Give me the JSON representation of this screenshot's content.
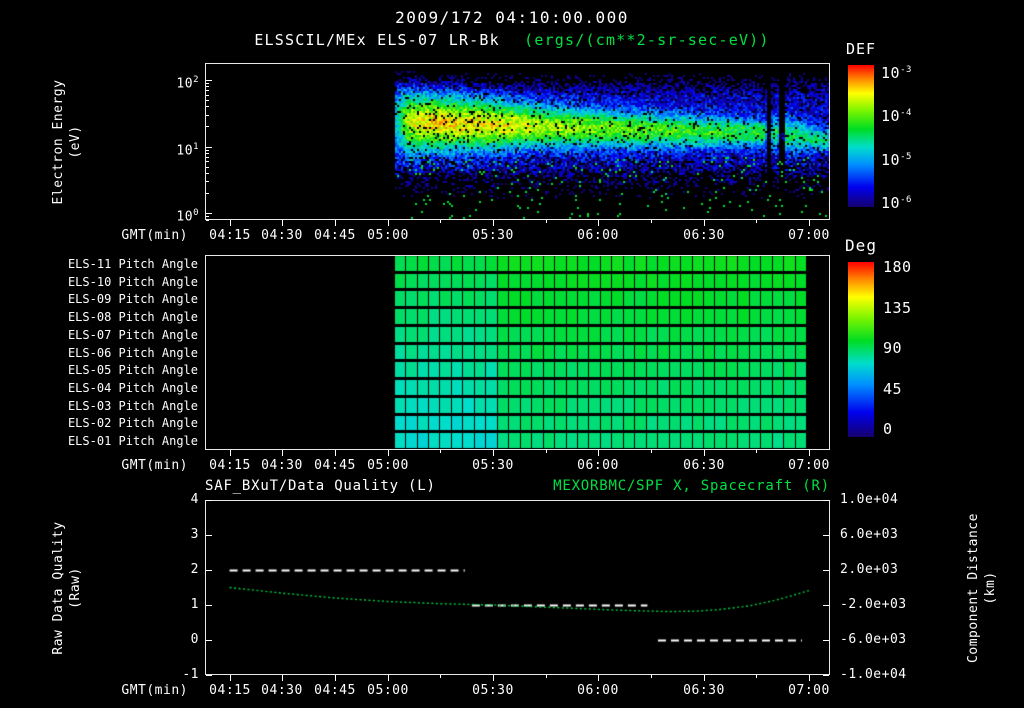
{
  "header": {
    "title": "2009/172 04:10:00.000",
    "subtitle_instrument": "ELSSCIL/MEx ELS-07 LR-Bk",
    "subtitle_units": "(ergs/(cm**2-sr-sec-eV))"
  },
  "colors": {
    "background": "#000000",
    "text": "#ffffff",
    "green_text": "#00e040",
    "curve_green": "#00cc44",
    "quality_line": "#ffffff",
    "colormap_stops": [
      {
        "pos": 0.0,
        "color": "#16006e"
      },
      {
        "pos": 0.14,
        "color": "#0000ee"
      },
      {
        "pos": 0.3,
        "color": "#0090ff"
      },
      {
        "pos": 0.42,
        "color": "#00ddcc"
      },
      {
        "pos": 0.55,
        "color": "#00dd22"
      },
      {
        "pos": 0.68,
        "color": "#7cf500"
      },
      {
        "pos": 0.8,
        "color": "#ffff00"
      },
      {
        "pos": 0.9,
        "color": "#ff8800"
      },
      {
        "pos": 1.0,
        "color": "#ff0000"
      }
    ]
  },
  "time_axis": {
    "label": "GMT(min)",
    "domain_min": 248,
    "domain_max": 426,
    "minor_tick_step": 15,
    "ticks": [
      {
        "minute": 255,
        "label": "04:15"
      },
      {
        "minute": 270,
        "label": "04:30"
      },
      {
        "minute": 285,
        "label": "04:45"
      },
      {
        "minute": 300,
        "label": "05:00"
      },
      {
        "minute": 330,
        "label": "05:30"
      },
      {
        "minute": 360,
        "label": "06:00"
      },
      {
        "minute": 390,
        "label": "06:30"
      },
      {
        "minute": 420,
        "label": "07:00"
      }
    ]
  },
  "chart_data": [
    {
      "id": "electron_energy_spectrogram",
      "type": "heatmap",
      "title": "ELSSCIL/MEx ELS-07 LR-Bk",
      "units": "ergs/(cm**2-sr-sec-eV)",
      "ylabel": [
        "Electron Energy",
        "(eV)"
      ],
      "y_scale": "log",
      "y_domain_log10_ev": [
        -0.1,
        2.25
      ],
      "yticks": [
        {
          "exponent": 2
        },
        {
          "exponent": 1
        },
        {
          "exponent": 0
        }
      ],
      "colorbar": {
        "title": "DEF",
        "range_log10_flux": [
          -6,
          -3
        ],
        "ticks": [
          {
            "exponent": -3
          },
          {
            "exponent": -4
          },
          {
            "exponent": -5
          },
          {
            "exponent": -6
          }
        ]
      },
      "data_start_minute": 302,
      "data_end_minute": 426,
      "background_log_flux": -5.7,
      "noise_log_flux": 0.35,
      "band_keyframes": {
        "minute": [
          302,
          306,
          312,
          330,
          345,
          365,
          385,
          400,
          407,
          408.5,
          410.5,
          412,
          413.5,
          417,
          421,
          426
        ],
        "peak_log_flux": [
          -4.9,
          -3.8,
          -3.55,
          -3.6,
          -3.85,
          -4.05,
          -4.2,
          -4.3,
          -4.35,
          -5.3,
          -4.25,
          -5.3,
          -4.45,
          -4.5,
          -4.6,
          -4.7
        ],
        "center_log10_ev": [
          1.4,
          1.37,
          1.35,
          1.33,
          1.3,
          1.26,
          1.23,
          1.21,
          1.2,
          1.2,
          1.2,
          1.2,
          1.18,
          1.15,
          1.12,
          1.1
        ],
        "width_log10_ev": [
          0.5,
          0.46,
          0.42,
          0.36,
          0.3,
          0.27,
          0.24,
          0.21,
          0.2,
          0.2,
          0.24,
          0.2,
          0.26,
          0.24,
          0.2,
          0.18
        ]
      },
      "dropout_lanes": [
        {
          "start_minute": 408,
          "end_minute": 409.3
        },
        {
          "start_minute": 411.6,
          "end_minute": 413
        }
      ]
    },
    {
      "id": "pitch_angles",
      "type": "heatmap",
      "colorbar": {
        "title": "Deg",
        "range_deg": [
          0,
          180
        ],
        "ticks": [
          180,
          135,
          90,
          45,
          0
        ]
      },
      "data_start_minute": 302,
      "data_end_minute": 419.5,
      "time_cells": 36,
      "early_transition_minute": 330,
      "rows_deg_top_to_bottom": [
        {
          "label": "ELS-11 Pitch Angle",
          "early_deg": 94,
          "late_deg": 100
        },
        {
          "label": "ELS-10 Pitch Angle",
          "early_deg": 92,
          "late_deg": 99
        },
        {
          "label": "ELS-09 Pitch Angle",
          "early_deg": 90,
          "late_deg": 97
        },
        {
          "label": "ELS-08 Pitch Angle",
          "early_deg": 88,
          "late_deg": 96
        },
        {
          "label": "ELS-07 Pitch Angle",
          "early_deg": 86,
          "late_deg": 94
        },
        {
          "label": "ELS-06 Pitch Angle",
          "early_deg": 84,
          "late_deg": 93
        },
        {
          "label": "ELS-05 Pitch Angle",
          "early_deg": 82,
          "late_deg": 91
        },
        {
          "label": "ELS-04 Pitch Angle",
          "early_deg": 80,
          "late_deg": 90
        },
        {
          "label": "ELS-03 Pitch Angle",
          "early_deg": 78,
          "late_deg": 89
        },
        {
          "label": "ELS-02 Pitch Angle",
          "early_deg": 76,
          "late_deg": 88
        },
        {
          "label": "ELS-01 Pitch Angle",
          "early_deg": 75,
          "late_deg": 87
        }
      ]
    },
    {
      "id": "quality_and_spacecraft_x",
      "type": "line",
      "title_left": "SAF_BXuT/Data Quality (L)",
      "title_right": "MEXORBMC/SPF X, Spacecraft (R)",
      "ylabel_left": [
        "Raw Data Quality",
        "(Raw)"
      ],
      "ylabel_right": [
        "Component Distance",
        "(km)"
      ],
      "y_left_domain": [
        -1,
        4
      ],
      "y_left_ticks": [
        4,
        3,
        2,
        1,
        0,
        -1
      ],
      "y_right_domain_km": [
        -10000,
        10000
      ],
      "y_right_tick_labels": [
        "1.0e+04",
        "6.0e+03",
        "2.0e+03",
        "-2.0e+03",
        "-6.0e+03",
        "-1.0e+04"
      ],
      "series": [
        {
          "name": "SAF_BXuT/Data Quality",
          "axis": "left",
          "style": "dashed",
          "color": "#ffffff",
          "segments": [
            {
              "start_minute": 255,
              "end_minute": 322,
              "value": 2
            },
            {
              "start_minute": 324,
              "end_minute": 374,
              "value": 1
            },
            {
              "start_minute": 377,
              "end_minute": 418,
              "value": 0
            }
          ]
        },
        {
          "name": "MEXORBMC/SPF X Spacecraft",
          "axis": "right",
          "style": "dotted",
          "color": "#00cc44",
          "points": {
            "minute": [
              255,
              270,
              285,
              300,
              315,
              330,
              345,
              360,
              370,
              380,
              388,
              395,
              403,
              410,
              415,
              420
            ],
            "km": [
              0,
              -650,
              -1200,
              -1600,
              -1850,
              -2000,
              -2250,
              -2500,
              -2650,
              -2750,
              -2700,
              -2500,
              -2100,
              -1500,
              -950,
              -350
            ]
          }
        }
      ]
    }
  ]
}
